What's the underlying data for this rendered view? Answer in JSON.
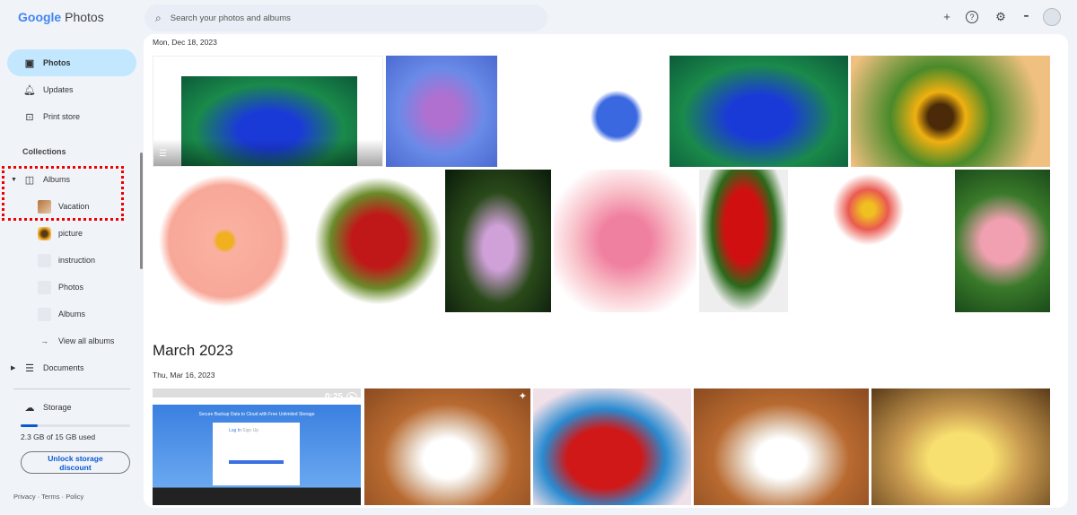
{
  "app": {
    "logo_google": "Google",
    "logo_photos": "Photos"
  },
  "search": {
    "placeholder": "Search your photos and albums"
  },
  "toolbar": {
    "add": "+",
    "help": "?",
    "settings": "⚙",
    "apps": "⋮⋮⋮"
  },
  "sidebar": {
    "items": [
      {
        "label": "Photos",
        "icon": "image-icon"
      },
      {
        "label": "Updates",
        "icon": "bell-icon"
      },
      {
        "label": "Print store",
        "icon": "bag-icon"
      }
    ],
    "collections_label": "Collections",
    "albums_label": "Albums",
    "albums": [
      "Vacation",
      "picture",
      "instruction",
      "Photos",
      "Albums"
    ],
    "view_all": "View all albums",
    "documents": "Documents",
    "storage_label": "Storage",
    "storage_used": "2.3 GB of 15 GB used",
    "storage_fraction": 0.153,
    "unlock_line1": "Unlock storage",
    "unlock_line2": "discount",
    "footer": {
      "privacy": "Privacy",
      "terms": "Terms",
      "policy": "Policy",
      "sep": "·"
    }
  },
  "main": {
    "date1": "Mon, Dec 18, 2023",
    "month2": "March 2023",
    "date2": "Thu, Mar 16, 2023",
    "video_duration": "0:25",
    "video_title": "Secure Backup Data to Cloud with Free Unlimited Storage",
    "video_tab1": "Log In",
    "video_tab2": "Sign Up"
  }
}
